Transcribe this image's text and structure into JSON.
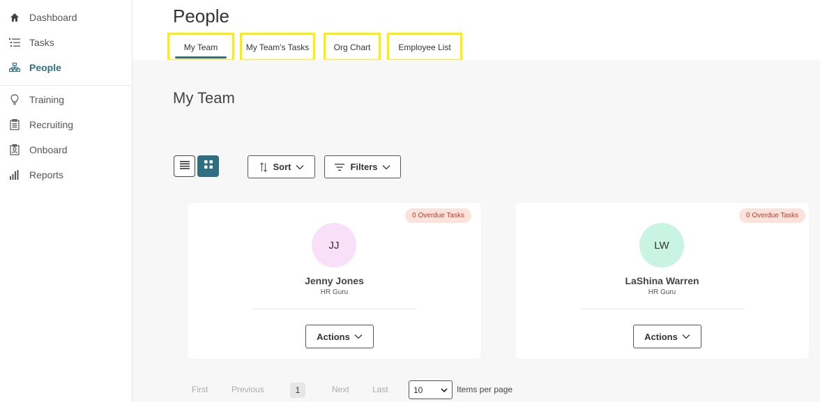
{
  "sidebar": {
    "items": [
      {
        "label": "Dashboard",
        "icon": "home-icon"
      },
      {
        "label": "Tasks",
        "icon": "task-list-icon"
      },
      {
        "label": "People",
        "icon": "org-chart-icon",
        "active": true
      },
      {
        "label": "Training",
        "icon": "lightbulb-icon"
      },
      {
        "label": "Recruiting",
        "icon": "clipboard-icon"
      },
      {
        "label": "Onboard",
        "icon": "badge-icon"
      },
      {
        "label": "Reports",
        "icon": "bar-chart-icon"
      }
    ]
  },
  "header": {
    "title": "People",
    "tabs": [
      {
        "label": "My Team",
        "active": true
      },
      {
        "label": "My Team's Tasks"
      },
      {
        "label": "Org Chart"
      },
      {
        "label": "Employee List"
      }
    ]
  },
  "main": {
    "section_title": "My Team",
    "sort_label": "Sort",
    "filters_label": "Filters",
    "cards": [
      {
        "initials": "JJ",
        "name": "Jenny Jones",
        "role": "HR Guru",
        "overdue": "0 Overdue Tasks",
        "avatar_color": "#f8e1f8",
        "actions_label": "Actions"
      },
      {
        "initials": "LW",
        "name": "LaShina Warren",
        "role": "HR Guru",
        "overdue": "0 Overdue Tasks",
        "avatar_color": "#c9f3e2",
        "actions_label": "Actions"
      }
    ],
    "pagination": {
      "first": "First",
      "previous": "Previous",
      "current": "1",
      "next": "Next",
      "last": "Last",
      "per_page": "10",
      "per_page_label": "Items per page"
    }
  },
  "colors": {
    "accent": "#2e6f80",
    "highlight": "#ffee00",
    "overdue_bg": "#fbe3dc",
    "overdue_text": "#c0392b"
  }
}
